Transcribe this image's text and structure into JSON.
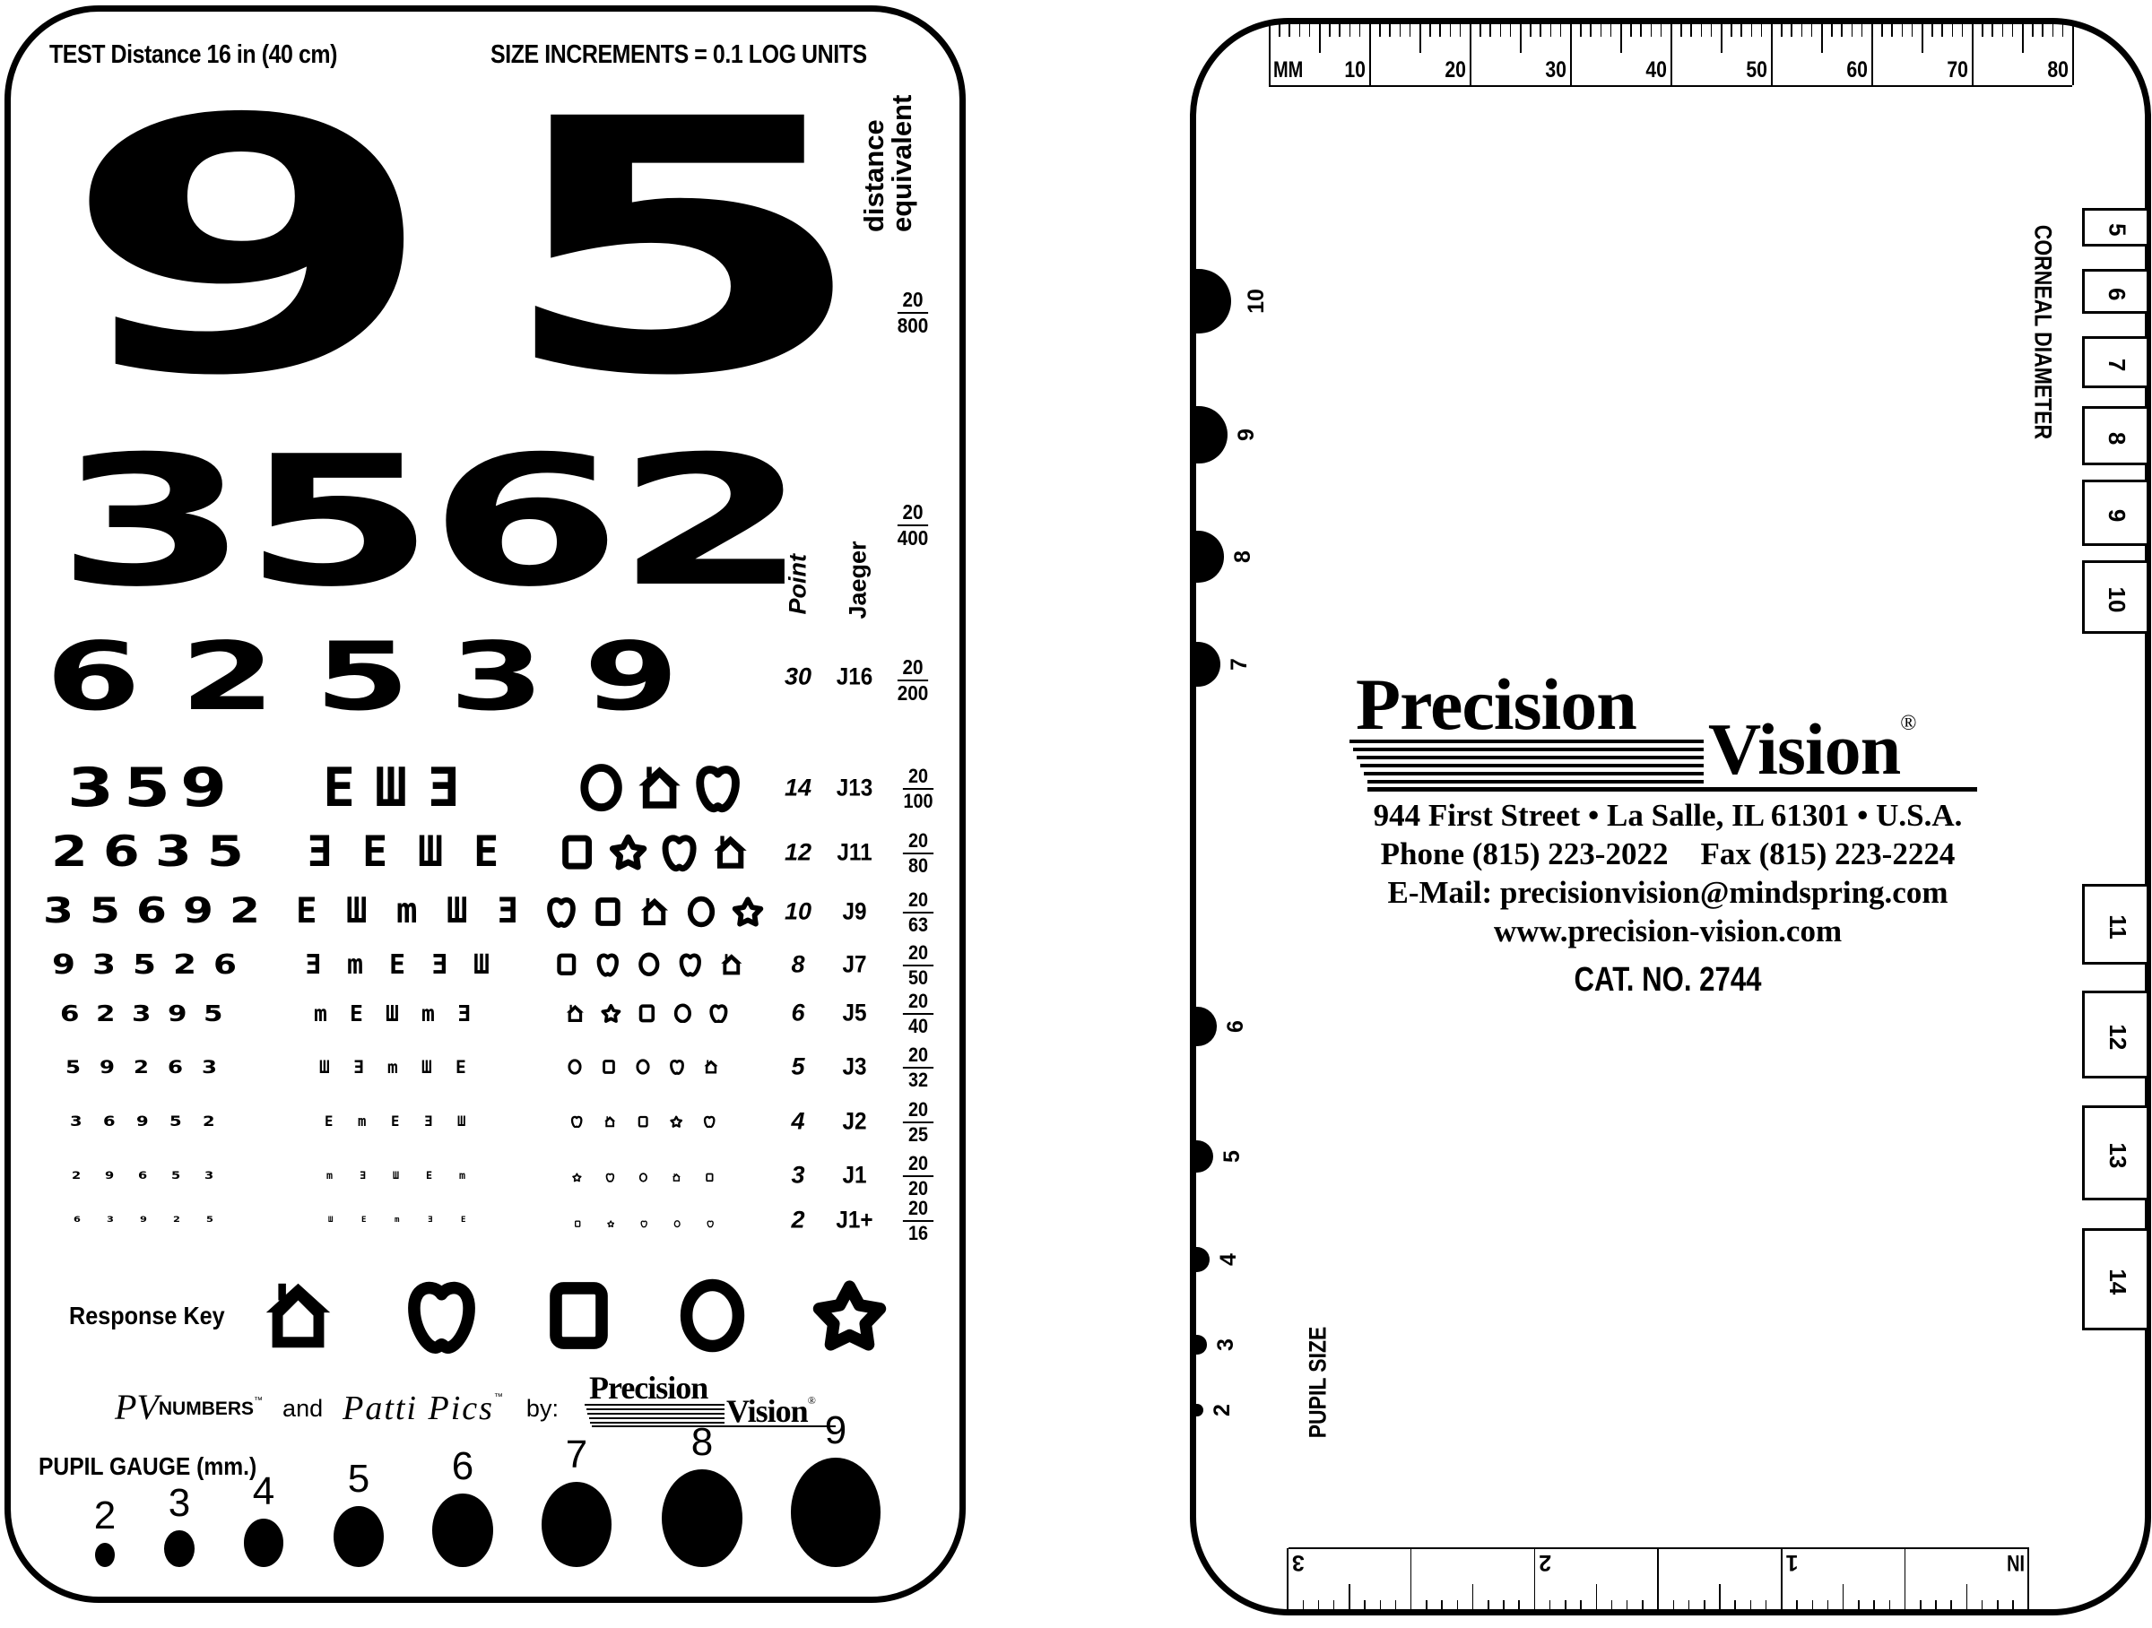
{
  "left_card": {
    "header_left": "TEST Distance 16 in (40 cm)",
    "header_right": "SIZE INCREMENTS = 0.1 LOG UNITS",
    "distance_equivalent_label": [
      "distance",
      "equivalent"
    ],
    "point_label": "Point",
    "jaeger_label": "Jaeger",
    "large_rows": [
      {
        "digits": [
          "9",
          "5"
        ],
        "acuity_num": "20",
        "acuity_den": "800"
      },
      {
        "digits": [
          "3",
          "5",
          "6",
          "2"
        ],
        "acuity_num": "20",
        "acuity_den": "400"
      },
      {
        "digits": [
          "6",
          "2",
          "5",
          "3",
          "9"
        ],
        "point": "30",
        "jaeger": "J16",
        "acuity_num": "20",
        "acuity_den": "200"
      }
    ],
    "rows": [
      {
        "digits": [
          "3",
          "5",
          "9"
        ],
        "letters": [
          "E",
          "Ш",
          "Ǝ"
        ],
        "symbols": [
          "circle",
          "house",
          "apple"
        ],
        "point": "14",
        "jaeger": "J13",
        "acuity_num": "20",
        "acuity_den": "100"
      },
      {
        "digits": [
          "2",
          "6",
          "3",
          "5"
        ],
        "letters": [
          "Ǝ",
          "E",
          "Ш",
          "E"
        ],
        "symbols": [
          "square",
          "star",
          "apple",
          "house"
        ],
        "point": "12",
        "jaeger": "J11",
        "acuity_num": "20",
        "acuity_den": "80"
      },
      {
        "digits": [
          "3",
          "5",
          "6",
          "9",
          "2"
        ],
        "letters": [
          "E",
          "Ш",
          "m",
          "Ш",
          "Ǝ"
        ],
        "symbols": [
          "apple",
          "square",
          "house",
          "circle",
          "star"
        ],
        "point": "10",
        "jaeger": "J9",
        "acuity_num": "20",
        "acuity_den": "63"
      },
      {
        "digits": [
          "9",
          "3",
          "5",
          "2",
          "6"
        ],
        "letters": [
          "Ǝ",
          "m",
          "E",
          "Ǝ",
          "Ш"
        ],
        "symbols": [
          "square",
          "apple",
          "circle",
          "apple",
          "house"
        ],
        "point": "8",
        "jaeger": "J7",
        "acuity_num": "20",
        "acuity_den": "50"
      },
      {
        "digits": [
          "6",
          "2",
          "3",
          "9",
          "5"
        ],
        "letters": [
          "m",
          "E",
          "Ш",
          "m",
          "Ǝ"
        ],
        "symbols": [
          "house",
          "star",
          "square",
          "circle",
          "apple"
        ],
        "point": "6",
        "jaeger": "J5",
        "acuity_num": "20",
        "acuity_den": "40"
      },
      {
        "digits": [
          "5",
          "9",
          "2",
          "6",
          "3"
        ],
        "letters": [
          "Ш",
          "Ǝ",
          "m",
          "Ш",
          "E"
        ],
        "symbols": [
          "circle",
          "square",
          "circle",
          "apple",
          "house"
        ],
        "point": "5",
        "jaeger": "J3",
        "acuity_num": "20",
        "acuity_den": "32"
      },
      {
        "digits": [
          "3",
          "6",
          "9",
          "5",
          "2"
        ],
        "letters": [
          "E",
          "m",
          "E",
          "Ǝ",
          "Ш"
        ],
        "symbols": [
          "apple",
          "house",
          "square",
          "star",
          "apple"
        ],
        "point": "4",
        "jaeger": "J2",
        "acuity_num": "20",
        "acuity_den": "25"
      },
      {
        "digits": [
          "2",
          "9",
          "6",
          "5",
          "3"
        ],
        "letters": [
          "m",
          "Ǝ",
          "Ш",
          "E",
          "m"
        ],
        "symbols": [
          "star",
          "apple",
          "circle",
          "house",
          "square"
        ],
        "point": "3",
        "jaeger": "J1",
        "acuity_num": "20",
        "acuity_den": "20"
      },
      {
        "digits": [
          "6",
          "3",
          "9",
          "2",
          "5"
        ],
        "letters": [
          "Ш",
          "E",
          "m",
          "Ǝ",
          "E"
        ],
        "symbols": [
          "square",
          "star",
          "apple",
          "circle",
          "apple"
        ],
        "point": "2",
        "jaeger": "J1+",
        "acuity_num": "20",
        "acuity_den": "16"
      }
    ],
    "response_key": {
      "label": "Response Key",
      "symbols": [
        "house",
        "apple",
        "square",
        "circle",
        "star"
      ]
    },
    "credits": {
      "pv_numbers": "PV",
      "pv_numbers_suffix": "NUMBERS",
      "tm": "™",
      "and": "and",
      "patti_pics": "Patti Pics",
      "by": "by:",
      "brand_top": "Precision",
      "brand_bottom": "Vision",
      "registered": "®"
    },
    "pupil_gauge": {
      "label": "PUPIL GAUGE (mm.)",
      "sizes_mm": [
        "2",
        "3",
        "4",
        "5",
        "6",
        "7",
        "8",
        "9"
      ]
    }
  },
  "right_card": {
    "mm_ruler": {
      "unit_label": "MM",
      "labels": [
        "10",
        "20",
        "30",
        "40",
        "50",
        "60",
        "70",
        "80"
      ]
    },
    "inch_ruler": {
      "unit_label": "IN",
      "labels": [
        "1",
        "2",
        "3"
      ]
    },
    "pupil_size": {
      "label": "PUPIL SIZE",
      "sizes_mm": [
        "10",
        "9",
        "8",
        "7",
        "6",
        "5",
        "4",
        "3",
        "2"
      ]
    },
    "corneal_diameter": {
      "label": "CORNEAL DIAMETER",
      "sizes_mm": [
        "5",
        "6",
        "7",
        "8",
        "9",
        "10",
        "11",
        "12",
        "13",
        "14"
      ]
    },
    "company": {
      "brand_top": "Precision",
      "brand_bottom": "Vision",
      "registered": "®",
      "address": "944 First Street • La Salle, IL 61301 • U.S.A.",
      "phone": "Phone (815) 223-2022",
      "fax": "Fax (815) 223-2224",
      "email": "E-Mail: precisionvision@mindspring.com",
      "website": "www.precision-vision.com",
      "catalog": "CAT. NO. 2744"
    }
  }
}
